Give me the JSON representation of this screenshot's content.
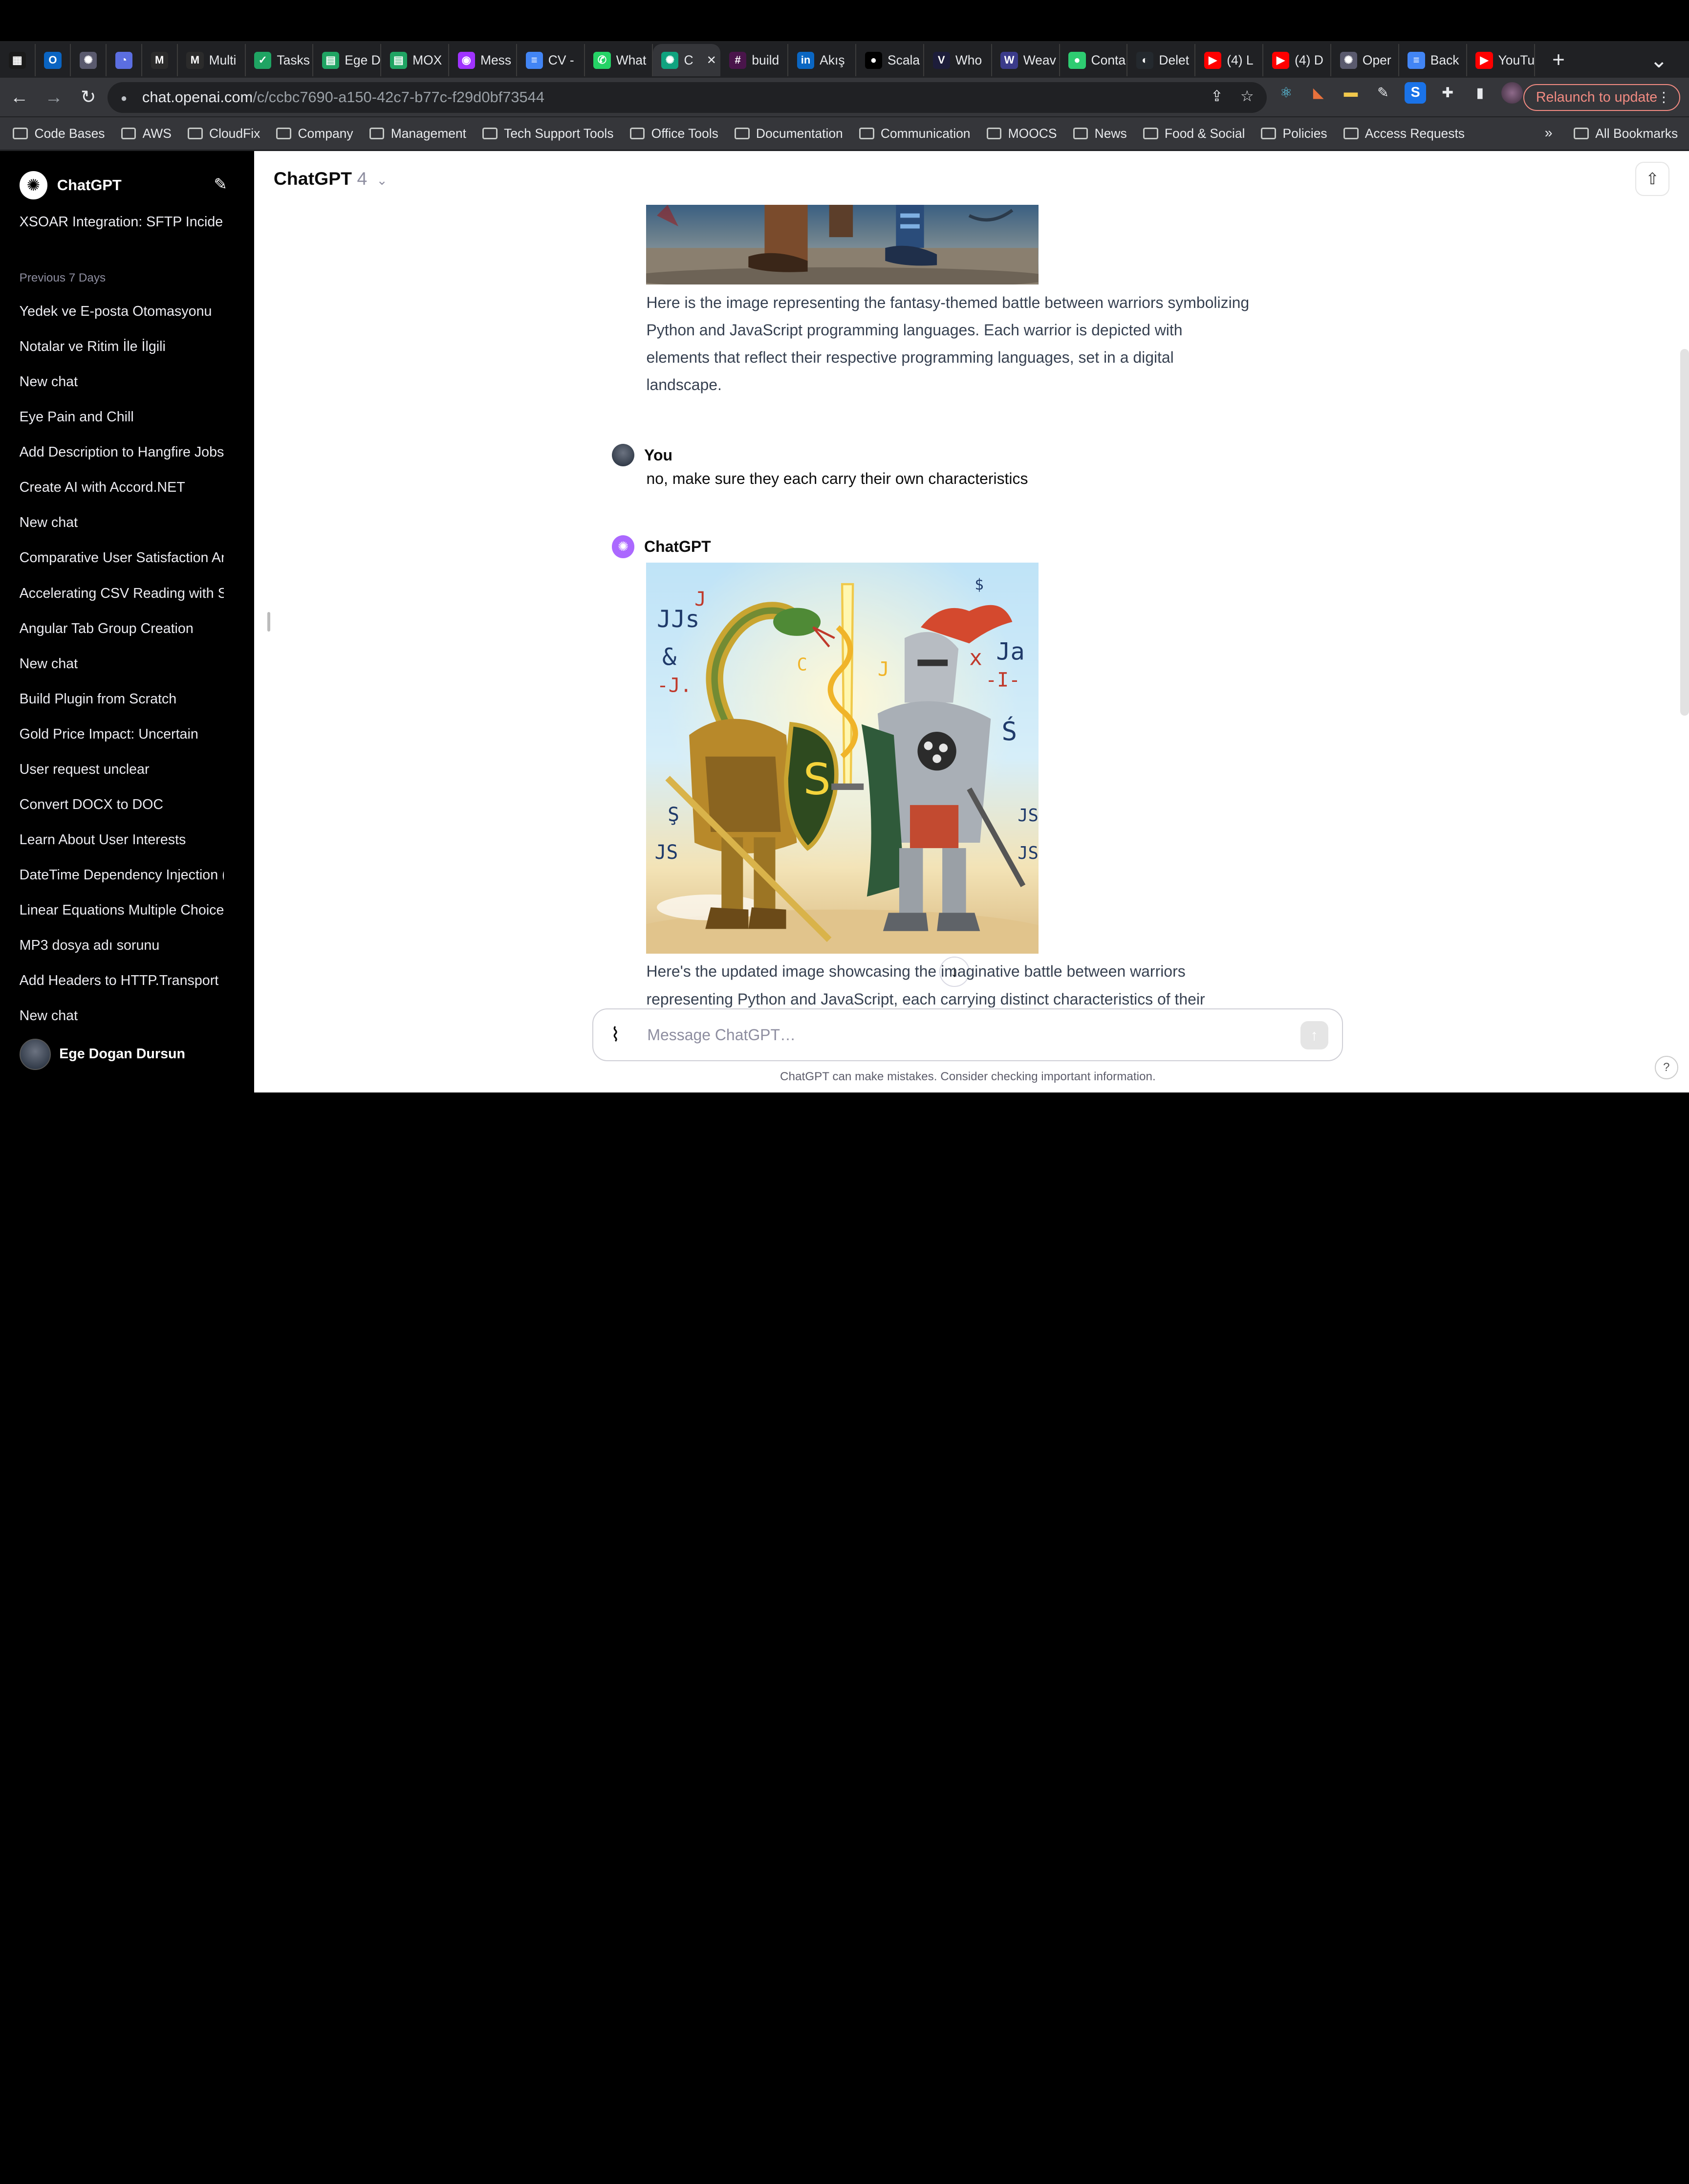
{
  "browser": {
    "tabs": [
      {
        "label": "",
        "icon": "grid-icon",
        "color": "#1a1a1a"
      },
      {
        "label": "",
        "icon": "outlook-icon",
        "color": "#0a64c2"
      },
      {
        "label": "",
        "icon": "chatgpt-icon",
        "color": "#5a5a6e"
      },
      {
        "label": "",
        "icon": "clock-icon",
        "color": "#5b6ee1"
      },
      {
        "label": "",
        "icon": "gmail-icon",
        "color": "#2b2b2b"
      },
      {
        "label": "Multi",
        "icon": "gmail-icon",
        "color": "#2b2b2b"
      },
      {
        "label": "Tasks",
        "icon": "tasks-icon",
        "color": "#1fa463"
      },
      {
        "label": "Ege D",
        "icon": "sheets-icon",
        "color": "#1fa463"
      },
      {
        "label": "MOX",
        "icon": "sheets-icon",
        "color": "#1fa463"
      },
      {
        "label": "Mess",
        "icon": "messenger-icon",
        "color": "#a033ff"
      },
      {
        "label": "CV -",
        "icon": "docs-icon",
        "color": "#4285f4"
      },
      {
        "label": "What",
        "icon": "whatsapp-icon",
        "color": "#25d366"
      },
      {
        "label": "C",
        "icon": "chatgpt-icon",
        "color": "#10a37f"
      },
      {
        "label": "build",
        "icon": "slack-icon",
        "color": "#4a154b"
      },
      {
        "label": "Akış",
        "icon": "linkedin-icon",
        "color": "#0a66c2"
      },
      {
        "label": "Scala",
        "icon": "medium-icon",
        "color": "#000000"
      },
      {
        "label": "Who",
        "icon": "v-icon",
        "color": "#1d1d3a"
      },
      {
        "label": "Weav",
        "icon": "weave-icon",
        "color": "#3b3b8a"
      },
      {
        "label": "Conta",
        "icon": "dot-icon",
        "color": "#2ecc71"
      },
      {
        "label": "Delet",
        "icon": "github-icon",
        "color": "#24292e"
      },
      {
        "label": "(4) L",
        "icon": "youtube-icon",
        "color": "#ff0000"
      },
      {
        "label": "(4) D",
        "icon": "youtube-icon",
        "color": "#ff0000"
      },
      {
        "label": "Oper",
        "icon": "chatgpt-icon",
        "color": "#5a5a6e"
      },
      {
        "label": "Back",
        "icon": "docs-icon",
        "color": "#4285f4"
      },
      {
        "label": "YouTu",
        "icon": "youtube-icon",
        "color": "#ff0000"
      }
    ],
    "url_host": "chat.openai.com",
    "url_path": "/c/ccbc7690-a150-42c7-b77c-f29d0bf73544",
    "relaunch_label": "Relaunch to update",
    "bookmarks": [
      "Code Bases",
      "AWS",
      "CloudFix",
      "Company",
      "Management",
      "Tech Support Tools",
      "Office Tools",
      "Documentation",
      "Communication",
      "MOOCS",
      "News",
      "Food & Social",
      "Policies",
      "Access Requests"
    ],
    "bookmarks_more": "»",
    "all_bookmarks": "All Bookmarks"
  },
  "sidebar": {
    "title": "ChatGPT",
    "top_item": "XSOAR Integration: SFTP Incident",
    "section_label": "Previous 7 Days",
    "items": [
      "Yedek ve E-posta Otomasyonu",
      "Notalar ve Ritim İle İlgili",
      "New chat",
      "Eye Pain and Chill",
      "Add Description to Hangfire Jobs",
      "Create AI with Accord.NET",
      "New chat",
      "Comparative User Satisfaction An",
      "Accelerating CSV Reading with Sl",
      "Angular Tab Group Creation",
      "New chat",
      "Build Plugin from Scratch",
      "Gold Price Impact: Uncertain",
      "User request unclear",
      "Convert DOCX to DOC",
      "Learn About User Interests",
      "DateTime Dependency Injection (",
      "Linear Equations Multiple Choice",
      "MP3 dosya adı sorunu",
      "Add Headers to HTTP.Transport",
      "New chat"
    ],
    "user_name": "Ege Dogan Dursun"
  },
  "chat": {
    "model_name": "ChatGPT",
    "model_version": "4",
    "assistant_text_1": "Here is the image representing the fantasy-themed battle between warriors symbolizing Python and JavaScript programming languages. Each warrior is depicted with elements that reflect their respective programming languages, set in a digital landscape.",
    "user_label": "You",
    "user_message": "no, make sure they each carry their own characteristics",
    "assistant_label": "ChatGPT",
    "assistant_text_2": "Here's the updated image showcasing the imaginative battle between warriors representing Python and JavaScript, each carrying distinct characteristics of their",
    "composer_placeholder": "Message ChatGPT…",
    "disclaimer": "ChatGPT can make mistakes. Consider checking important information.",
    "help_label": "?"
  },
  "colors": {
    "sidebar_bg": "#000000",
    "chatgpt_avatar": "#ab68ff",
    "relaunch": "#f28b82"
  }
}
